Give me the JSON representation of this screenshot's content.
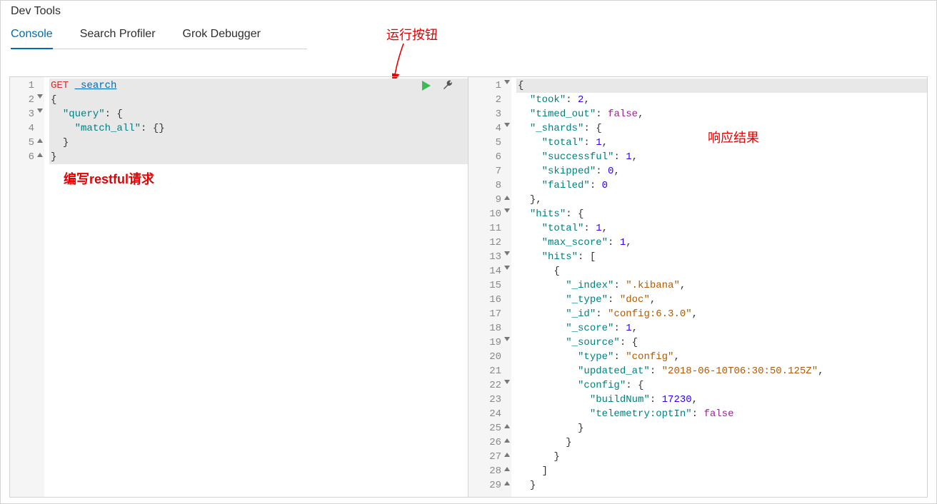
{
  "title": "Dev Tools",
  "tabs": [
    {
      "label": "Console",
      "active": true
    },
    {
      "label": "Search Profiler",
      "active": false
    },
    {
      "label": "Grok Debugger",
      "active": false
    }
  ],
  "annotations": {
    "run_button": "运行按钮",
    "write_request": "编写restful请求",
    "response_result": "响应结果"
  },
  "request": {
    "method": "GET",
    "path": "_search",
    "body_lines": [
      {
        "n": 1,
        "fold": "",
        "indent": 0,
        "tokens": [
          [
            "kw",
            "GET"
          ],
          [
            "punc",
            " "
          ],
          [
            "path",
            "_search"
          ]
        ],
        "hl": true
      },
      {
        "n": 2,
        "fold": "down",
        "indent": 0,
        "tokens": [
          [
            "punc",
            "{"
          ]
        ],
        "hl": true
      },
      {
        "n": 3,
        "fold": "down",
        "indent": 2,
        "tokens": [
          [
            "key",
            "\"query\""
          ],
          [
            "punc",
            ": {"
          ]
        ],
        "hl": true
      },
      {
        "n": 4,
        "fold": "",
        "indent": 4,
        "tokens": [
          [
            "key",
            "\"match_all\""
          ],
          [
            "punc",
            ": {}"
          ]
        ],
        "hl": true
      },
      {
        "n": 5,
        "fold": "up",
        "indent": 2,
        "tokens": [
          [
            "punc",
            "}"
          ]
        ],
        "hl": true
      },
      {
        "n": 6,
        "fold": "up",
        "indent": 0,
        "tokens": [
          [
            "punc",
            "}"
          ]
        ],
        "hl": true
      }
    ]
  },
  "response": {
    "lines": [
      {
        "n": 1,
        "fold": "down",
        "indent": 0,
        "tokens": [
          [
            "punc",
            "{"
          ]
        ],
        "hl": true
      },
      {
        "n": 2,
        "fold": "",
        "indent": 2,
        "tokens": [
          [
            "key",
            "\"took\""
          ],
          [
            "punc",
            ": "
          ],
          [
            "num",
            "2"
          ],
          [
            "punc",
            ","
          ]
        ]
      },
      {
        "n": 3,
        "fold": "",
        "indent": 2,
        "tokens": [
          [
            "key",
            "\"timed_out\""
          ],
          [
            "punc",
            ": "
          ],
          [
            "bool",
            "false"
          ],
          [
            "punc",
            ","
          ]
        ]
      },
      {
        "n": 4,
        "fold": "down",
        "indent": 2,
        "tokens": [
          [
            "key",
            "\"_shards\""
          ],
          [
            "punc",
            ": {"
          ]
        ]
      },
      {
        "n": 5,
        "fold": "",
        "indent": 4,
        "tokens": [
          [
            "key",
            "\"total\""
          ],
          [
            "punc",
            ": "
          ],
          [
            "num",
            "1"
          ],
          [
            "punc",
            ","
          ]
        ]
      },
      {
        "n": 6,
        "fold": "",
        "indent": 4,
        "tokens": [
          [
            "key",
            "\"successful\""
          ],
          [
            "punc",
            ": "
          ],
          [
            "num",
            "1"
          ],
          [
            "punc",
            ","
          ]
        ]
      },
      {
        "n": 7,
        "fold": "",
        "indent": 4,
        "tokens": [
          [
            "key",
            "\"skipped\""
          ],
          [
            "punc",
            ": "
          ],
          [
            "num",
            "0"
          ],
          [
            "punc",
            ","
          ]
        ]
      },
      {
        "n": 8,
        "fold": "",
        "indent": 4,
        "tokens": [
          [
            "key",
            "\"failed\""
          ],
          [
            "punc",
            ": "
          ],
          [
            "num",
            "0"
          ]
        ]
      },
      {
        "n": 9,
        "fold": "up",
        "indent": 2,
        "tokens": [
          [
            "punc",
            "},"
          ]
        ]
      },
      {
        "n": 10,
        "fold": "down",
        "indent": 2,
        "tokens": [
          [
            "key",
            "\"hits\""
          ],
          [
            "punc",
            ": {"
          ]
        ]
      },
      {
        "n": 11,
        "fold": "",
        "indent": 4,
        "tokens": [
          [
            "key",
            "\"total\""
          ],
          [
            "punc",
            ": "
          ],
          [
            "num",
            "1"
          ],
          [
            "punc",
            ","
          ]
        ]
      },
      {
        "n": 12,
        "fold": "",
        "indent": 4,
        "tokens": [
          [
            "key",
            "\"max_score\""
          ],
          [
            "punc",
            ": "
          ],
          [
            "num",
            "1"
          ],
          [
            "punc",
            ","
          ]
        ]
      },
      {
        "n": 13,
        "fold": "down",
        "indent": 4,
        "tokens": [
          [
            "key",
            "\"hits\""
          ],
          [
            "punc",
            ": ["
          ]
        ]
      },
      {
        "n": 14,
        "fold": "down",
        "indent": 6,
        "tokens": [
          [
            "punc",
            "{"
          ]
        ]
      },
      {
        "n": 15,
        "fold": "",
        "indent": 8,
        "tokens": [
          [
            "key",
            "\"_index\""
          ],
          [
            "punc",
            ": "
          ],
          [
            "str",
            "\".kibana\""
          ],
          [
            "punc",
            ","
          ]
        ]
      },
      {
        "n": 16,
        "fold": "",
        "indent": 8,
        "tokens": [
          [
            "key",
            "\"_type\""
          ],
          [
            "punc",
            ": "
          ],
          [
            "str",
            "\"doc\""
          ],
          [
            "punc",
            ","
          ]
        ]
      },
      {
        "n": 17,
        "fold": "",
        "indent": 8,
        "tokens": [
          [
            "key",
            "\"_id\""
          ],
          [
            "punc",
            ": "
          ],
          [
            "str",
            "\"config:6.3.0\""
          ],
          [
            "punc",
            ","
          ]
        ]
      },
      {
        "n": 18,
        "fold": "",
        "indent": 8,
        "tokens": [
          [
            "key",
            "\"_score\""
          ],
          [
            "punc",
            ": "
          ],
          [
            "num",
            "1"
          ],
          [
            "punc",
            ","
          ]
        ]
      },
      {
        "n": 19,
        "fold": "down",
        "indent": 8,
        "tokens": [
          [
            "key",
            "\"_source\""
          ],
          [
            "punc",
            ": {"
          ]
        ]
      },
      {
        "n": 20,
        "fold": "",
        "indent": 10,
        "tokens": [
          [
            "key",
            "\"type\""
          ],
          [
            "punc",
            ": "
          ],
          [
            "str",
            "\"config\""
          ],
          [
            "punc",
            ","
          ]
        ]
      },
      {
        "n": 21,
        "fold": "",
        "indent": 10,
        "tokens": [
          [
            "key",
            "\"updated_at\""
          ],
          [
            "punc",
            ": "
          ],
          [
            "str",
            "\"2018-06-10T06:30:50.125Z\""
          ],
          [
            "punc",
            ","
          ]
        ]
      },
      {
        "n": 22,
        "fold": "down",
        "indent": 10,
        "tokens": [
          [
            "key",
            "\"config\""
          ],
          [
            "punc",
            ": {"
          ]
        ]
      },
      {
        "n": 23,
        "fold": "",
        "indent": 12,
        "tokens": [
          [
            "key",
            "\"buildNum\""
          ],
          [
            "punc",
            ": "
          ],
          [
            "num",
            "17230"
          ],
          [
            "punc",
            ","
          ]
        ]
      },
      {
        "n": 24,
        "fold": "",
        "indent": 12,
        "tokens": [
          [
            "key",
            "\"telemetry:optIn\""
          ],
          [
            "punc",
            ": "
          ],
          [
            "bool",
            "false"
          ]
        ]
      },
      {
        "n": 25,
        "fold": "up",
        "indent": 10,
        "tokens": [
          [
            "punc",
            "}"
          ]
        ]
      },
      {
        "n": 26,
        "fold": "up",
        "indent": 8,
        "tokens": [
          [
            "punc",
            "}"
          ]
        ]
      },
      {
        "n": 27,
        "fold": "up",
        "indent": 6,
        "tokens": [
          [
            "punc",
            "}"
          ]
        ]
      },
      {
        "n": 28,
        "fold": "up",
        "indent": 4,
        "tokens": [
          [
            "punc",
            "]"
          ]
        ]
      },
      {
        "n": 29,
        "fold": "up",
        "indent": 2,
        "tokens": [
          [
            "punc",
            "}"
          ]
        ]
      }
    ]
  }
}
